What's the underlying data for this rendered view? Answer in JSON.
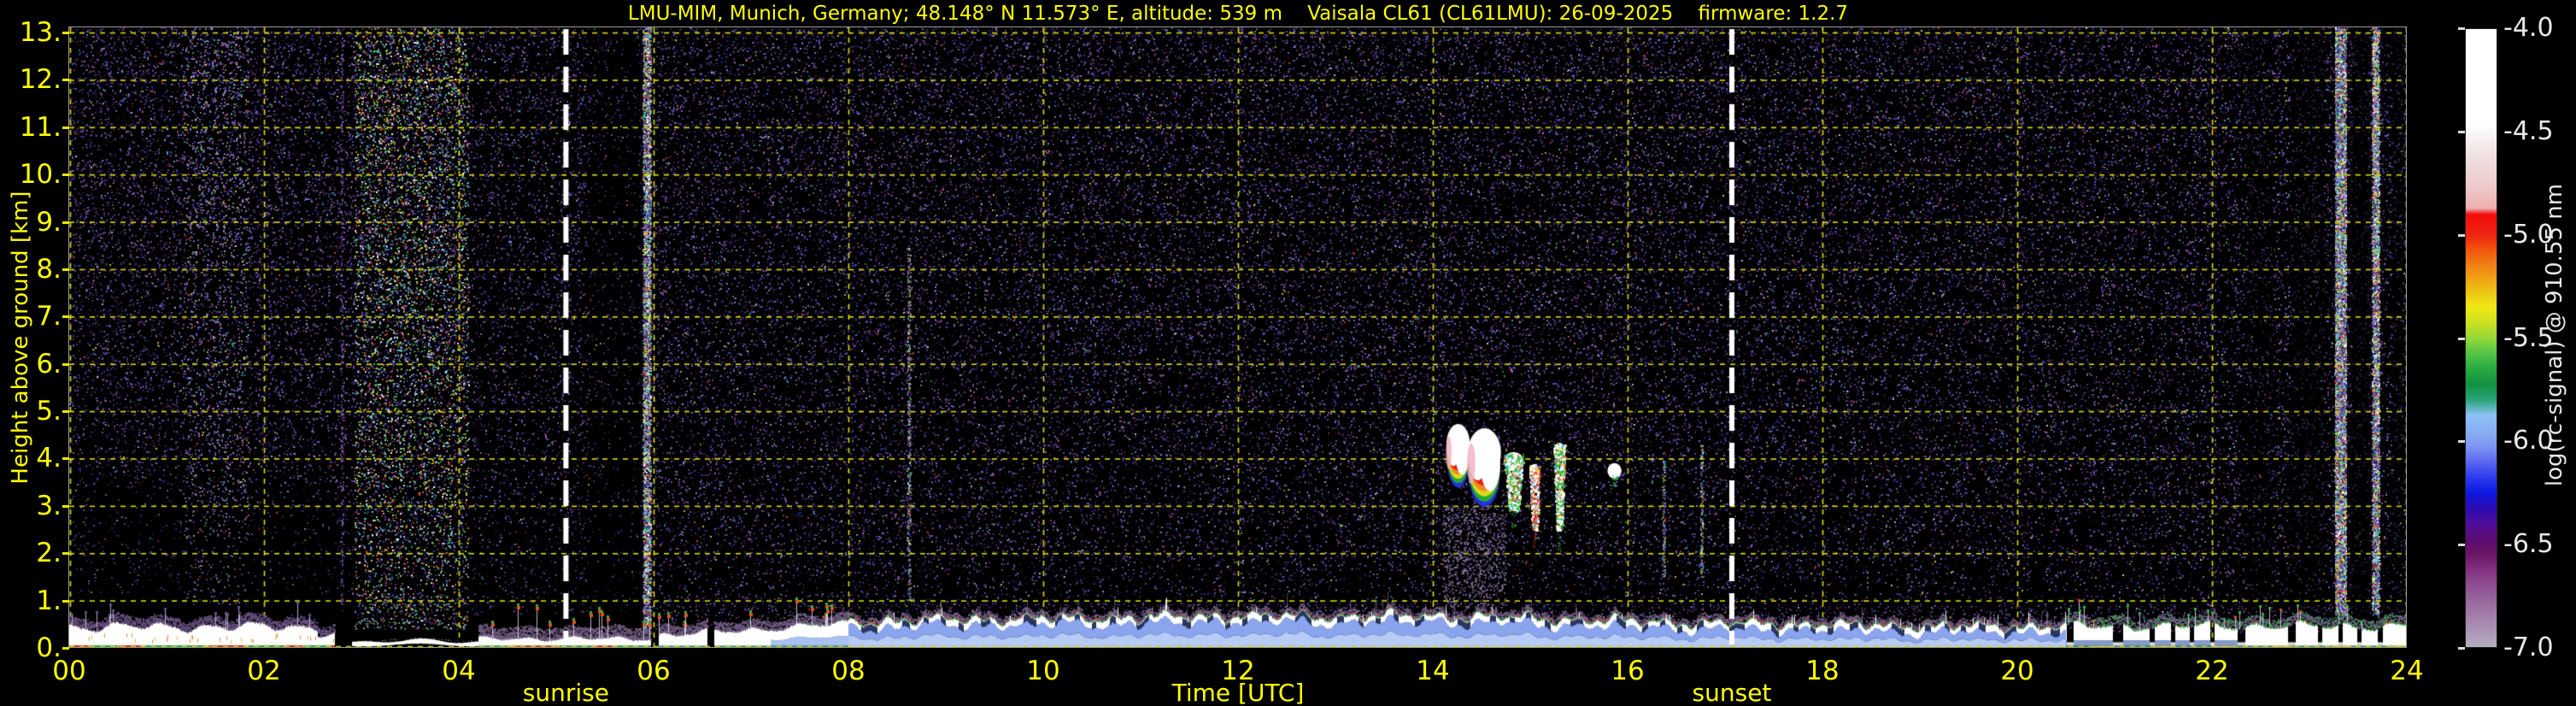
{
  "chart_data": {
    "type": "heatmap",
    "title": "LMU-MIM, Munich, Germany; 48.148° N 11.573° E, altitude: 539 m    Vaisala CL61 (CL61LMU): 26-09-2025    firmware: 1.2.7",
    "xlabel": "Time [UTC]",
    "ylabel": "Height above ground [km]",
    "x_ticks": [
      "00",
      "02",
      "04",
      "06",
      "08",
      "10",
      "12",
      "14",
      "16",
      "18",
      "20",
      "22",
      "24"
    ],
    "x_range": [
      0,
      24
    ],
    "x_step_hours": 2,
    "y_ticks": [
      "0.",
      "1.",
      "2.",
      "3.",
      "4.",
      "5.",
      "6.",
      "7.",
      "8.",
      "9.",
      "10.",
      "11.",
      "12.",
      "13."
    ],
    "y_range_km": [
      0,
      13.11
    ],
    "grid": {
      "color": "#e8e800",
      "x_step_hours": 2,
      "y_step_km": 1,
      "style": "dashed"
    },
    "text_color": "#ffff00",
    "cb_text_color": "#e8e8e8",
    "annotations": {
      "sunrise_label": "sunrise",
      "sunrise_hour": 5.1,
      "sunset_label": "sunset",
      "sunset_hour": 17.07,
      "line_color": "#ffffff"
    },
    "colorbar": {
      "label": "log(rc-signal) @ 910.55 nm",
      "ticks": [
        "-4.0",
        "-4.5",
        "-5.0",
        "-5.5",
        "-6.0",
        "-6.5",
        "-7.0"
      ],
      "vmax": -4.0,
      "vmin": -7.0,
      "stops": [
        [
          "#ffffff",
          0
        ],
        [
          "#ffffff",
          0.155
        ],
        [
          "#f2e8e8",
          0.19
        ],
        [
          "#eed8d8",
          0.225
        ],
        [
          "#eec6c6",
          0.26
        ],
        [
          "#eeb0b0",
          0.29
        ],
        [
          "#f20c0c",
          0.3
        ],
        [
          "#ee2410",
          0.333
        ],
        [
          "#f2500c",
          0.355
        ],
        [
          "#f07c14",
          0.38
        ],
        [
          "#f0a414",
          0.405
        ],
        [
          "#eccc14",
          0.43
        ],
        [
          "#f0e814",
          0.45
        ],
        [
          "#cce022",
          0.475
        ],
        [
          "#96d838",
          0.5
        ],
        [
          "#52c446",
          0.525
        ],
        [
          "#28aa40",
          0.55
        ],
        [
          "#129240",
          0.575
        ],
        [
          "#28a478",
          0.6
        ],
        [
          "#8cc0f6",
          0.625
        ],
        [
          "#88b0f4",
          0.65
        ],
        [
          "#7e96f2",
          0.675
        ],
        [
          "#5a68f0",
          0.7
        ],
        [
          "#2c3cee",
          0.725
        ],
        [
          "#0c18e0",
          0.75
        ],
        [
          "#2a0cb4",
          0.775
        ],
        [
          "#500c9c",
          0.8
        ],
        [
          "#5c0c74",
          0.825
        ],
        [
          "#6a1464",
          0.85
        ],
        [
          "#833080",
          0.875
        ],
        [
          "#8f4e92",
          0.9
        ],
        [
          "#9b6ba1",
          0.93
        ],
        [
          "#a98cb2",
          0.965
        ],
        [
          "#b6aec2",
          1
        ]
      ]
    },
    "palettes": {
      "purple": [
        "#55307c",
        "#65408f",
        "#7550a2",
        "#452664",
        "#855fb0",
        "#371f50",
        "#8f6fbc",
        "#4f2f85"
      ],
      "purple_light": [
        "#7c5aa8",
        "#8a68b6",
        "#9678c4",
        "#6a4a9a",
        "#a288cc"
      ],
      "blue": [
        "#4343cc",
        "#5560e0",
        "#2d2db2",
        "#6a78ea"
      ],
      "accent_med": [
        "#3ab0cc",
        "#c6c0d8",
        "#2fa84e",
        "#ccc43c",
        "#cc4848",
        "#7aa8e0"
      ],
      "accent_bright": [
        "#42c8e2",
        "#34c054",
        "#e8e232",
        "#f09232",
        "#e84444",
        "#ffffff",
        "#e8e4f4",
        "#62bcf2",
        "#8ce0c8",
        "#a0dc3c"
      ]
    },
    "noise_bands": [
      {
        "from": 0.0,
        "to": 1.17,
        "density": 24,
        "floor_km": 3.3,
        "mode": "med"
      },
      {
        "from": 1.17,
        "to": 1.85,
        "density": 36,
        "floor_km": 2.6,
        "mode": "light"
      },
      {
        "from": 1.85,
        "to": 2.93,
        "density": 24,
        "floor_km": 3.2,
        "mode": "med"
      },
      {
        "from": 2.93,
        "to": 4.1,
        "density": 62,
        "floor_km": 1.15,
        "mode": "bright"
      },
      {
        "from": 4.1,
        "to": 5.35,
        "density": 21,
        "floor_km": 2.0,
        "mode": "med"
      },
      {
        "from": 5.35,
        "to": 5.92,
        "density": 11,
        "floor_km": 2.2,
        "mode": "med"
      },
      {
        "from": 5.92,
        "to": 8.0,
        "density": 26,
        "floor_km": 1.15,
        "mode": "med"
      },
      {
        "from": 8.0,
        "to": 17.1,
        "density": 27,
        "floor_km": 0.95,
        "mode": "med"
      },
      {
        "from": 17.1,
        "to": 22.0,
        "density": 26,
        "floor_km": 0.9,
        "mode": "med"
      },
      {
        "from": 22.0,
        "to": 24.0,
        "density": 26,
        "floor_km": 0.9,
        "mode": "med"
      }
    ],
    "dark_columns": [
      {
        "from": 5.3,
        "to": 5.9,
        "alpha": 0.2
      },
      {
        "from": 22.33,
        "to": 22.62,
        "alpha": 0.35
      },
      {
        "from": 22.8,
        "to": 23.15,
        "alpha": 0.45
      },
      {
        "from": 23.44,
        "to": 23.61,
        "alpha": 0.6
      },
      {
        "from": 23.85,
        "to": 23.97,
        "alpha": 0.35
      }
    ],
    "streaks": [
      {
        "h": 2.8,
        "w": 3,
        "km0": 0.7,
        "km1": 12.8,
        "density": 0.45,
        "mode": "purple",
        "faint": false
      },
      {
        "h": 5.93,
        "w": 9,
        "km0": 0.4,
        "km1": 13.1,
        "density": 1.8,
        "mode": "bright",
        "faint": false
      },
      {
        "h": 8.62,
        "w": 4,
        "km0": 1.0,
        "km1": 8.5,
        "density": 0.8,
        "mode": "bright",
        "faint": true
      },
      {
        "h": 16.37,
        "w": 3,
        "km0": 1.5,
        "km1": 3.95,
        "density": 1.2,
        "mode": "bright",
        "faint": true
      },
      {
        "h": 16.76,
        "w": 3,
        "km0": 1.5,
        "km1": 4.3,
        "density": 1.2,
        "mode": "bright",
        "faint": true
      },
      {
        "h": 23.32,
        "w": 13,
        "km0": 0.7,
        "km1": 13.1,
        "density": 2.6,
        "mode": "bright",
        "faint": false
      },
      {
        "h": 23.68,
        "w": 8,
        "km0": 0.7,
        "km1": 13.1,
        "density": 2.6,
        "mode": "bright",
        "faint": false
      }
    ],
    "clouds": {
      "blobs": [
        {
          "h0": 14.14,
          "h1": 14.38,
          "km_top": 4.68,
          "km_bot": 3.45,
          "type": "blob"
        },
        {
          "h0": 14.36,
          "h1": 14.7,
          "km_top": 4.58,
          "km_bot": 3.05,
          "type": "blob"
        },
        {
          "h0": 14.73,
          "h1": 14.93,
          "km_top": 4.1,
          "km_bot": 2.9,
          "type": "col",
          "color": "#30c040"
        },
        {
          "h0": 14.99,
          "h1": 15.1,
          "km_top": 3.85,
          "km_bot": 2.5,
          "type": "col",
          "color": "#e03424"
        },
        {
          "h0": 15.24,
          "h1": 15.36,
          "km_top": 4.3,
          "km_bot": 2.5,
          "type": "col",
          "color": "#30c040"
        },
        {
          "h0": 15.81,
          "h1": 15.92,
          "km_top": 3.85,
          "km_bot": 3.4,
          "type": "colsmall",
          "color": "#30c040"
        }
      ],
      "haze": {
        "h0": 14.1,
        "h1": 14.75,
        "km0": 0.85,
        "km1": 3.0
      }
    },
    "boundary_layer": {
      "gaps": [
        [
          2.72,
          2.9
        ],
        [
          5.97,
          6.05
        ],
        [
          6.55,
          6.62
        ]
      ],
      "segments": [
        {
          "from": 0.0,
          "to": 2.55,
          "style": "night",
          "base": 0.45,
          "wig": 0.13,
          "spike": 0.05
        },
        {
          "from": 2.55,
          "to": 2.72,
          "style": "night",
          "base": 0.3,
          "wig": 0.08,
          "spike": 0.02
        },
        {
          "from": 2.72,
          "to": 2.9,
          "style": "gap"
        },
        {
          "from": 2.9,
          "to": 4.2,
          "style": "thinline"
        },
        {
          "from": 4.2,
          "to": 6.0,
          "style": "shallow",
          "base": 0.2,
          "wig": 0.06,
          "spike": 0.055
        },
        {
          "from": 6.0,
          "to": 8.0,
          "style": "grow",
          "base": 0.26,
          "base2": 0.52,
          "wig": 0.09,
          "spike": 0.075
        },
        {
          "from": 8.0,
          "to": 17.0,
          "style": "cbl",
          "wig": 0.12,
          "spike": 0.02
        },
        {
          "from": 17.0,
          "to": 20.5,
          "style": "cbl",
          "wig": 0.1,
          "spike": 0.02
        },
        {
          "from": 20.5,
          "to": 24.0,
          "style": "evening",
          "base": 0.46,
          "wig": 0.12,
          "spike": 0.05
        }
      ],
      "cbl_top_profile": [
        [
          8,
          0.55
        ],
        [
          9,
          0.6
        ],
        [
          10,
          0.62
        ],
        [
          11,
          0.64
        ],
        [
          12,
          0.68
        ],
        [
          13,
          0.66
        ],
        [
          14,
          0.68
        ],
        [
          15,
          0.63
        ],
        [
          16,
          0.56
        ],
        [
          17,
          0.52
        ],
        [
          18,
          0.5
        ],
        [
          19,
          0.46
        ],
        [
          20.5,
          0.45
        ]
      ]
    }
  }
}
